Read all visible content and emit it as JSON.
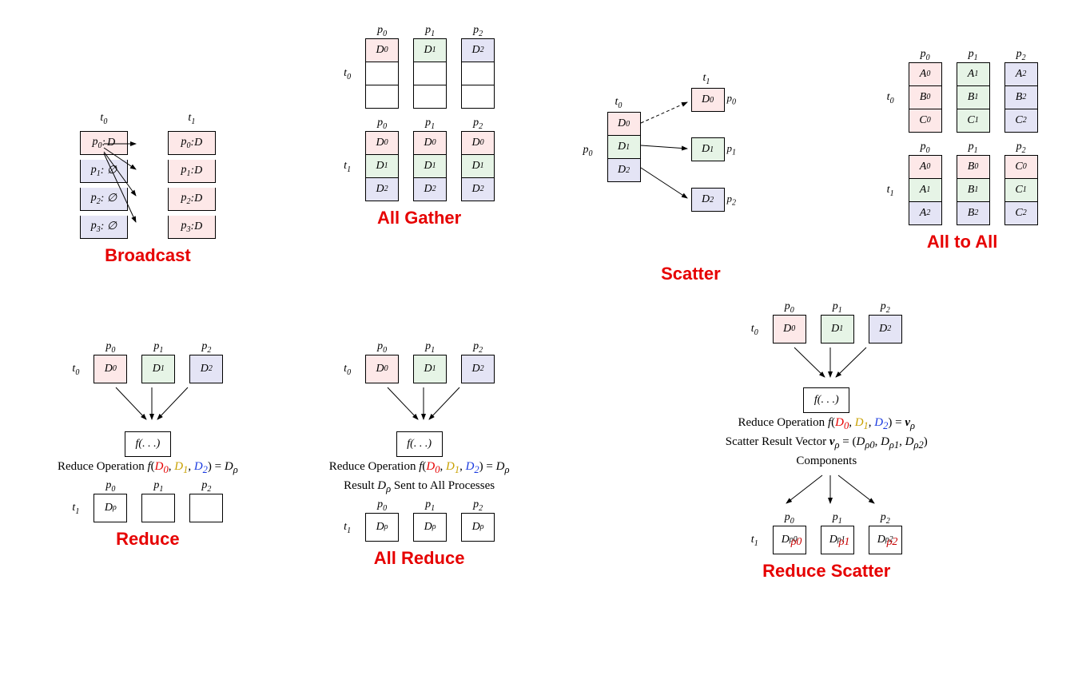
{
  "titles": {
    "broadcast": "Broadcast",
    "allgather": "All Gather",
    "scatter": "Scatter",
    "alltoall": "All to All",
    "reduce": "Reduce",
    "allreduce": "All Reduce",
    "reducescatter": "Reduce Scatter"
  },
  "labels": {
    "t0": "t",
    "t1": "t",
    "p0": "p",
    "p1": "p",
    "p2": "p",
    "p3": "p"
  },
  "broadcast": {
    "t0": [
      {
        "p": "p",
        "i": 0,
        "val": "D",
        "cls": "pink"
      },
      {
        "p": "p",
        "i": 1,
        "val": "∅",
        "cls": "blue"
      },
      {
        "p": "p",
        "i": 2,
        "val": "∅",
        "cls": "blue"
      },
      {
        "p": "p",
        "i": 3,
        "val": "∅",
        "cls": "blue"
      }
    ],
    "t1": [
      {
        "p": "p",
        "i": 0,
        "val": "D",
        "cls": "pink"
      },
      {
        "p": "p",
        "i": 1,
        "val": "D",
        "cls": "pink"
      },
      {
        "p": "p",
        "i": 2,
        "val": "D",
        "cls": "pink"
      },
      {
        "p": "p",
        "i": 3,
        "val": "D",
        "cls": "pink"
      }
    ]
  },
  "allgather": {
    "cols": [
      "0",
      "1",
      "2"
    ],
    "t0": [
      [
        "D0",
        "",
        ""
      ],
      [
        "",
        "D1",
        ""
      ],
      [
        "",
        "",
        "D2"
      ]
    ],
    "t0cls": [
      [
        "pink",
        "",
        ""
      ],
      [
        "",
        "green",
        ""
      ],
      [
        "",
        "",
        "blue"
      ]
    ],
    "t1": [
      [
        "D0",
        "D0",
        "D0"
      ],
      [
        "D1",
        "D1",
        "D1"
      ],
      [
        "D2",
        "D2",
        "D2"
      ]
    ],
    "t1cls": [
      [
        "pink",
        "pink",
        "pink"
      ],
      [
        "green",
        "green",
        "green"
      ],
      [
        "blue",
        "blue",
        "blue"
      ]
    ]
  },
  "scatter": {
    "src": [
      "D0",
      "D1",
      "D2"
    ],
    "srcCls": [
      "pink",
      "green",
      "blue"
    ],
    "dst": [
      "D0",
      "D1",
      "D2"
    ],
    "dstCls": [
      "pink",
      "green",
      "blue"
    ]
  },
  "alltoall": {
    "t0": [
      [
        "A0",
        "A1",
        "A2"
      ],
      [
        "B0",
        "B1",
        "B2"
      ],
      [
        "C0",
        "C1",
        "C2"
      ]
    ],
    "t0cls": [
      [
        "pink",
        "green",
        "blue"
      ],
      [
        "pink",
        "green",
        "blue"
      ],
      [
        "pink",
        "green",
        "blue"
      ]
    ],
    "t1": [
      [
        "A0",
        "B0",
        "C0"
      ],
      [
        "A1",
        "B1",
        "C1"
      ],
      [
        "A2",
        "B2",
        "C2"
      ]
    ],
    "t1cls": [
      [
        "pink",
        "pink",
        "pink"
      ],
      [
        "green",
        "green",
        "green"
      ],
      [
        "blue",
        "blue",
        "blue"
      ]
    ]
  },
  "reduce": {
    "inputs": [
      "D0",
      "D1",
      "D2"
    ],
    "inCls": [
      "pink",
      "green",
      "blue"
    ],
    "fbox": "f(. . .)",
    "caption_prefix": "Reduce Operation ",
    "outputs": [
      "Dρ",
      "",
      ""
    ],
    "colors": {
      "d0": "#e60000",
      "d1": "#c9a100",
      "d2": "#1a3be0"
    }
  },
  "allreduce": {
    "caption2": "Result Dρ Sent to All Processes",
    "outputs": [
      "Dρ",
      "Dρ",
      "Dρ"
    ]
  },
  "reducescatter": {
    "caption1_prefix": "Reduce Operation ",
    "caption2": "Scatter Result Vector ",
    "caption3": "Components",
    "outputs": [
      "Dρ0",
      "Dρ1",
      "Dρ2"
    ],
    "hand": [
      "ρ0",
      "ρ1",
      "ρ2"
    ]
  }
}
